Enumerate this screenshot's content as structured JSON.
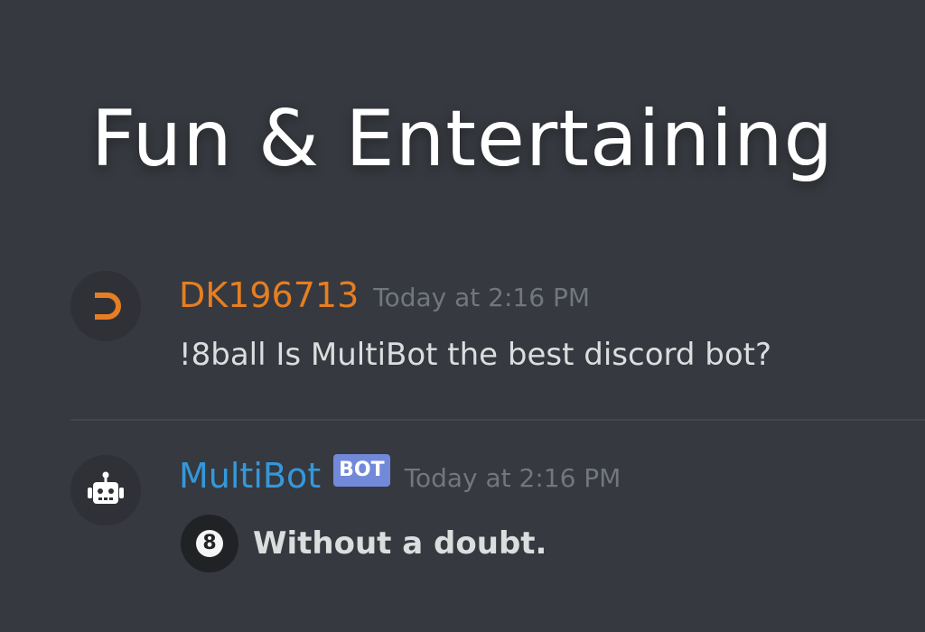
{
  "heading": "Fun & Entertaining",
  "messages": [
    {
      "username": "DK196713",
      "username_color": "#e67e22",
      "timestamp": "Today at 2:16 PM",
      "content": "!8ball Is MultiBot the best discord bot?",
      "avatar_icon": "orange-u-turn-logo-icon"
    },
    {
      "username": "MultiBot",
      "username_color": "#3498db",
      "bot_tag": "BOT",
      "timestamp": "Today at 2:16 PM",
      "content_icon_label": "8",
      "content": "Without a doubt.",
      "avatar_icon": "robot-icon"
    }
  ],
  "colors": {
    "background": "#36393f",
    "avatar_background": "#2f3136",
    "bot_tag": "#7289da",
    "timestamp": "#72767d",
    "text": "#dcddde"
  }
}
